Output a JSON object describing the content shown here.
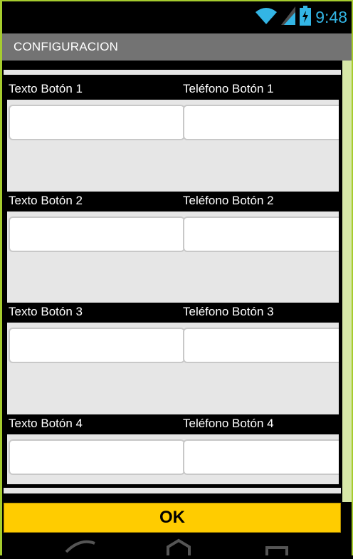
{
  "status_bar": {
    "time": "9:48",
    "icons": [
      "wifi-icon",
      "signal-icon",
      "battery-icon"
    ],
    "accent_color": "#33b5e5"
  },
  "title_bar": {
    "title": "CONFIGURACION"
  },
  "form": {
    "rows": [
      {
        "text_label": "Texto Botón 1",
        "phone_label": "Teléfono Botón 1",
        "text_value": "",
        "phone_value": ""
      },
      {
        "text_label": "Texto Botón 2",
        "phone_label": "Teléfono Botón 2",
        "text_value": "",
        "phone_value": ""
      },
      {
        "text_label": "Texto Botón 3",
        "phone_label": "Teléfono Botón 3",
        "text_value": "",
        "phone_value": ""
      },
      {
        "text_label": "Texto Botón 4",
        "phone_label": "Teléfono Botón 4",
        "text_value": "",
        "phone_value": ""
      }
    ]
  },
  "ok_button": {
    "label": "OK",
    "color": "#ffcc00"
  },
  "nav_bar": {
    "icons": [
      "back-icon",
      "home-icon",
      "recents-icon"
    ]
  }
}
